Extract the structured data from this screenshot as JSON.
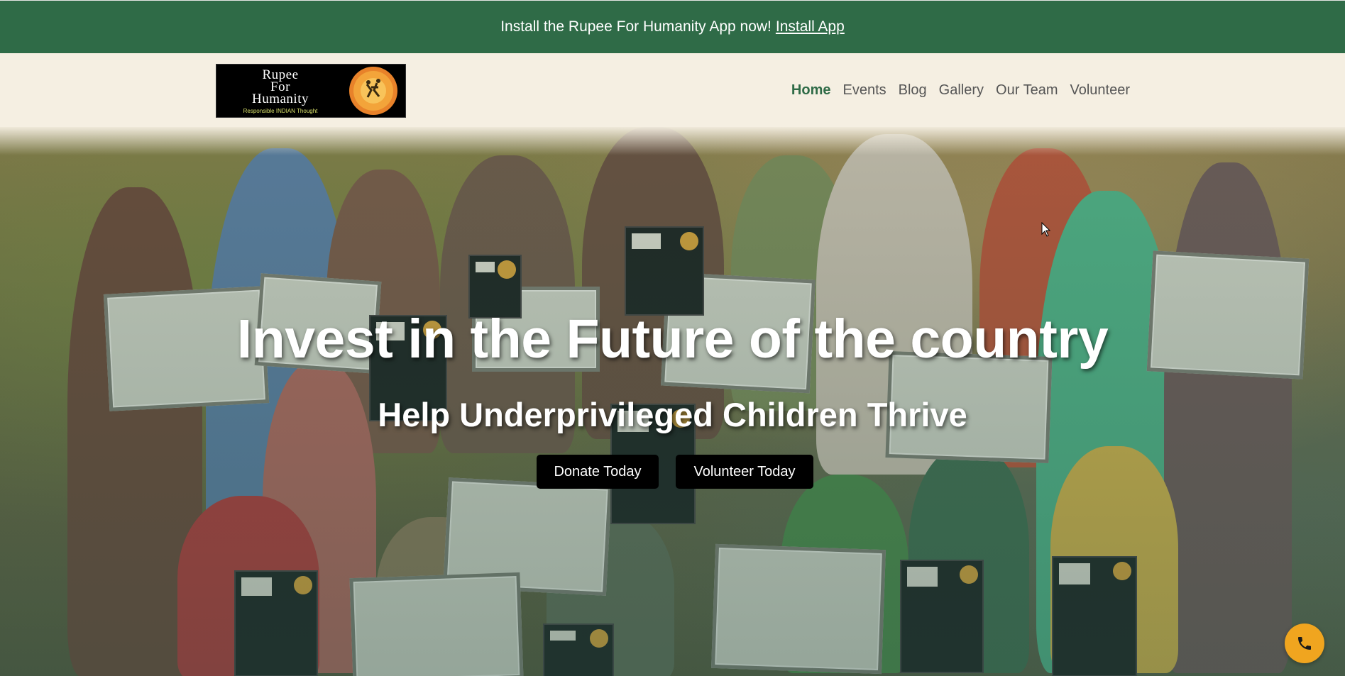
{
  "banner": {
    "text": "Install the Rupee For Humanity App now!",
    "link_label": "Install App"
  },
  "logo": {
    "line1": "Rupee",
    "line2": "For",
    "line3": "Humanity",
    "tagline": "Responsible INDIAN Thought"
  },
  "nav": {
    "items": [
      {
        "label": "Home",
        "active": true
      },
      {
        "label": "Events"
      },
      {
        "label": "Blog"
      },
      {
        "label": "Gallery"
      },
      {
        "label": "Our Team"
      },
      {
        "label": "Volunteer"
      }
    ]
  },
  "hero": {
    "title": "Invest in the Future of the country",
    "subtitle": "Help Underprivileged Children Thrive",
    "donate_label": "Donate Today",
    "volunteer_label": "Volunteer Today"
  },
  "floating": {
    "call_icon": "phone-icon"
  },
  "colors": {
    "banner_bg": "#2f6b47",
    "header_bg": "#f5efe2",
    "nav_active": "#2f6b47",
    "cta_bg": "#000000",
    "call_bg": "#f0a51f"
  }
}
